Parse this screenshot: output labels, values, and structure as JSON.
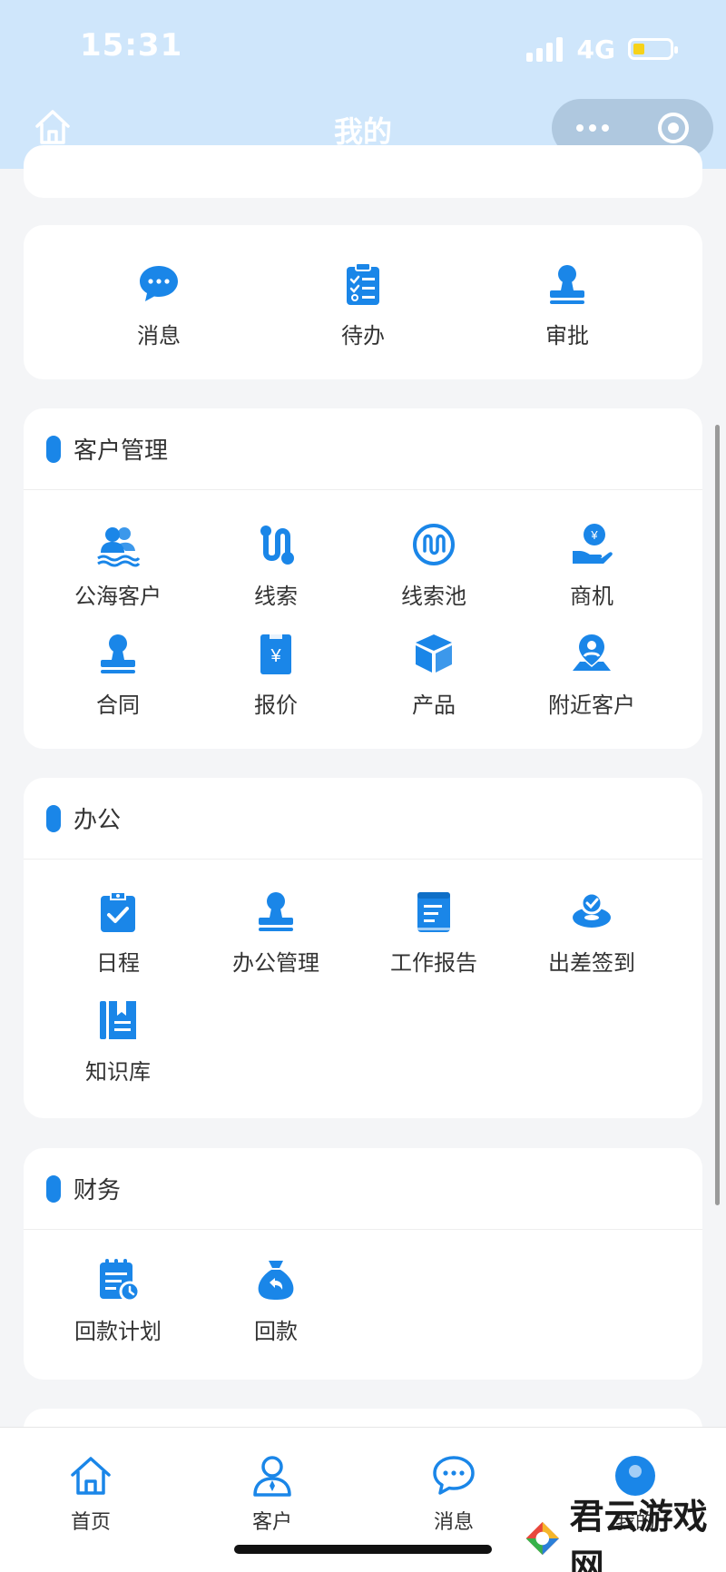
{
  "status": {
    "time": "15:31",
    "network": "4G"
  },
  "header": {
    "title": "我的"
  },
  "quick": {
    "items": [
      {
        "label": "消息",
        "icon": "chat-bubble-icon"
      },
      {
        "label": "待办",
        "icon": "checklist-icon"
      },
      {
        "label": "审批",
        "icon": "stamp-icon"
      }
    ]
  },
  "customer": {
    "title": "客户管理",
    "items": [
      {
        "label": "公海客户",
        "icon": "customer-pool-icon"
      },
      {
        "label": "线索",
        "icon": "lead-path-icon"
      },
      {
        "label": "线索池",
        "icon": "lead-pool-icon"
      },
      {
        "label": "商机",
        "icon": "opportunity-icon"
      },
      {
        "label": "合同",
        "icon": "contract-stamp-icon"
      },
      {
        "label": "报价",
        "icon": "quote-icon"
      },
      {
        "label": "产品",
        "icon": "product-box-icon"
      },
      {
        "label": "附近客户",
        "icon": "nearby-location-icon"
      }
    ]
  },
  "office": {
    "title": "办公",
    "items": [
      {
        "label": "日程",
        "icon": "schedule-clipboard-icon"
      },
      {
        "label": "办公管理",
        "icon": "office-stamp-icon"
      },
      {
        "label": "工作报告",
        "icon": "report-book-icon"
      },
      {
        "label": "出差签到",
        "icon": "checkin-icon"
      },
      {
        "label": "知识库",
        "icon": "knowledge-book-icon"
      }
    ]
  },
  "finance": {
    "title": "财务",
    "items": [
      {
        "label": "回款计划",
        "icon": "payment-plan-icon"
      },
      {
        "label": "回款",
        "icon": "money-bag-icon"
      }
    ]
  },
  "tabs": [
    {
      "label": "首页",
      "icon": "home-icon"
    },
    {
      "label": "客户",
      "icon": "customer-icon"
    },
    {
      "label": "消息",
      "icon": "message-icon"
    },
    {
      "label": "我的",
      "icon": "profile-icon"
    }
  ],
  "watermark": {
    "text": "君云游戏网"
  },
  "colors": {
    "accent": "#1a86e8",
    "header_bg": "#cfe6fb"
  }
}
